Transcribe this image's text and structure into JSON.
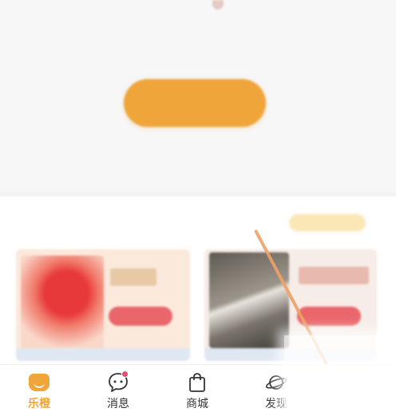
{
  "colors": {
    "accent": "#f0a53b",
    "badge": "#e54d6f",
    "promo_button": "#e9676b"
  },
  "tab_bar": {
    "items": [
      {
        "label": "乐橙",
        "icon": "home-smile-icon",
        "active": true
      },
      {
        "label": "消息",
        "icon": "message-bubble-icon",
        "active": false,
        "badge": true
      },
      {
        "label": "商城",
        "icon": "shopping-bag-icon",
        "active": false
      },
      {
        "label": "发现",
        "icon": "planet-icon",
        "active": false
      }
    ]
  }
}
